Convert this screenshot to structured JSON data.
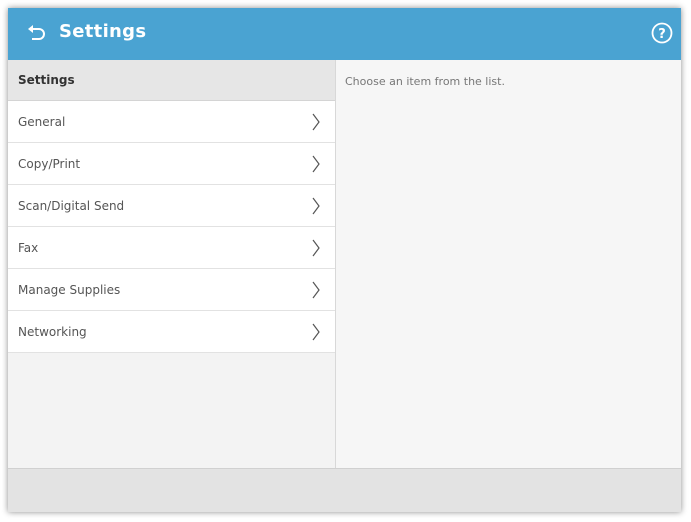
{
  "header": {
    "title": "Settings",
    "back_icon": "back-arrow-icon",
    "help_icon": "help-icon",
    "color": "#4aa3d2"
  },
  "sidebar": {
    "heading": "Settings",
    "items": [
      {
        "label": "General",
        "icon": "chevron-right-icon"
      },
      {
        "label": "Copy/Print",
        "icon": "chevron-right-icon"
      },
      {
        "label": "Scan/Digital Send",
        "icon": "chevron-right-icon"
      },
      {
        "label": "Fax",
        "icon": "chevron-right-icon"
      },
      {
        "label": "Manage Supplies",
        "icon": "chevron-right-icon"
      },
      {
        "label": "Networking",
        "icon": "chevron-right-icon"
      }
    ]
  },
  "content": {
    "hint": "Choose an item from the list."
  }
}
